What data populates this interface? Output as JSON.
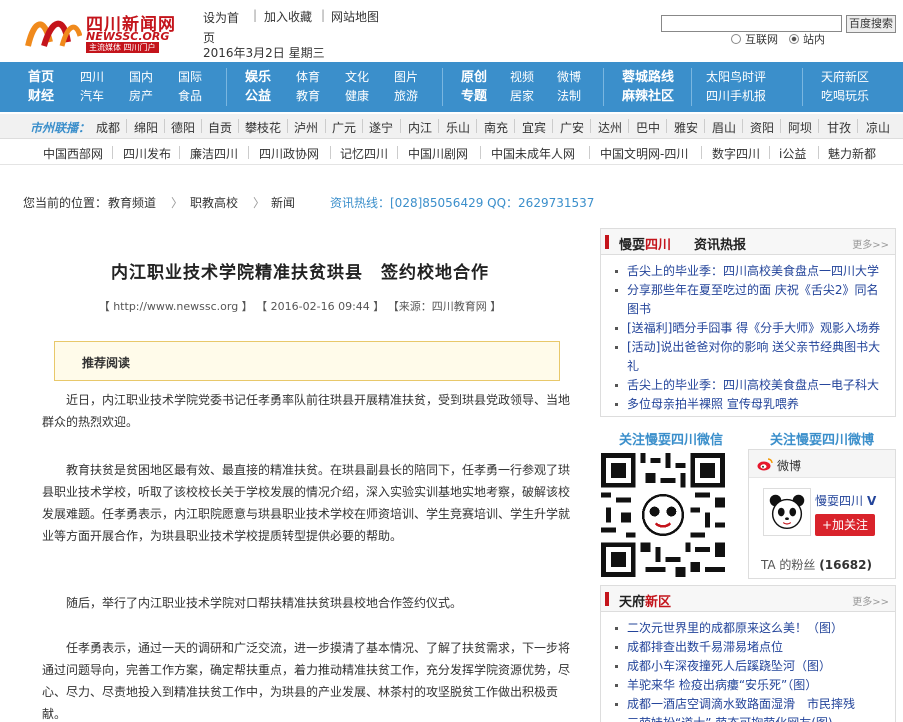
{
  "logo": {
    "name": "四川新闻网",
    "domain": "NEWSSC.ORG",
    "slogan": "主流媒体 四川门户"
  },
  "toplinks": {
    "home": "设为首页",
    "favorite": "加入收藏",
    "sitemap": "网站地图",
    "sep": "|"
  },
  "date": "2016年3月2日 星期三",
  "search": {
    "button": "百度搜索",
    "opt_web": "互联网",
    "opt_site": "站内",
    "selected": "站内"
  },
  "mainnav": [
    {
      "top": "首页",
      "bottom": "财经",
      "bold": true
    },
    {
      "top": "四川",
      "bottom": "汽车"
    },
    {
      "top": "国内",
      "bottom": "房产"
    },
    {
      "top": "国际",
      "bottom": "食品"
    },
    {
      "top": "娱乐",
      "bottom": "公益",
      "bold": true
    },
    {
      "top": "体育",
      "bottom": "教育"
    },
    {
      "top": "文化",
      "bottom": "健康"
    },
    {
      "top": "图片",
      "bottom": "旅游"
    },
    {
      "top": "原创",
      "bottom": "专题",
      "bold": true
    },
    {
      "top": "视频",
      "bottom": "居家"
    },
    {
      "top": "微博",
      "bottom": "法制"
    },
    {
      "top": "蓉城路线",
      "bottom": "麻辣社区",
      "bold": true
    },
    {
      "top": "太阳鸟时评",
      "bottom": "四川手机报"
    },
    {
      "top": "天府新区",
      "bottom": "吃喝玩乐"
    }
  ],
  "citybar": {
    "label": "市州联播：",
    "cities": [
      "成都",
      "绵阳",
      "德阳",
      "自贡",
      "攀枝花",
      "泸州",
      "广元",
      "遂宁",
      "内江",
      "乐山",
      "南充",
      "宜宾",
      "广安",
      "达州",
      "巴中",
      "雅安",
      "眉山",
      "资阳",
      "阿坝",
      "甘孜",
      "凉山"
    ]
  },
  "friendlinks": [
    "中国西部网",
    "四川发布",
    "廉洁四川",
    "四川政协网",
    "记忆四川",
    "中国川剧网",
    "中国未成年人网",
    "中国文明网-四川",
    "数字四川",
    "i公益",
    "魅力新都"
  ],
  "breadcrumb": {
    "label": "您当前的位置：",
    "items": [
      "教育频道",
      "职教高校",
      "新闻"
    ],
    "sep": "〉"
  },
  "hotline": "资讯热线：[028]85056429 QQ：2629731537",
  "article": {
    "title": "内江职业技术学院精准扶贫珙县　签约校地合作",
    "meta": "【 http://www.newssc.org 】 【 2016-02-16 09:44 】 【来源：四川教育网 】",
    "recommend": "推荐阅读",
    "paragraphs": [
      "近日，内江职业技术学院党委书记任孝勇率队前往珙县开展精准扶贫，受到珙县党政领导、当地群众的热烈欢迎。",
      "教育扶贫是贫困地区最有效、最直接的精准扶贫。在珙县副县长的陪同下，任孝勇一行参观了珙县职业技术学校，听取了该校校长关于学校发展的情况介绍，深入实验实训基地实地考察，破解该校发展难题。任孝勇表示，内江职院愿意与珙县职业技术学校在师资培训、学生竞赛培训、学生升学就业等方面开展合作，为珙县职业技术学校提质转型提供必要的帮助。",
      "随后，举行了内江职业技术学院对口帮扶精准扶贫珙县校地合作签约仪式。",
      "任孝勇表示，通过一天的调研和广泛交流，进一步摸清了基本情况、了解了扶贫需求，下一步将通过问题导向，完善工作方案，确定帮扶重点，着力推动精准扶贫工作，充分发挥学院资源优势，尽心、尽力、尽责地投入到精准扶贫工作中，为珙县的产业发展、林茶村的攻坚脱贫工作做出积极贡献。"
    ]
  },
  "hot": {
    "title_a": "慢耍",
    "title_b": "四川",
    "title_c": "资讯热报",
    "more": "更多>>",
    "items": [
      "舌尖上的毕业季：四川高校美食盘点一四川大学",
      "分享那些年在夏至吃过的面 庆祝《舌尖2》同名图书",
      "[送福利]晒分手囧事 得《分手大师》观影入场券",
      "[活动]说出爸爸对你的影响 送父亲节经典图书大礼",
      "舌尖上的毕业季：四川高校美食盘点一电子科大",
      "多位母亲拍半裸照 宣传母乳喂养"
    ]
  },
  "follow": {
    "weixin": "关注慢耍四川微信",
    "weibo": "关注慢耍四川微博"
  },
  "weibo_card": {
    "header": "微博",
    "name": "慢耍四川",
    "badge": "V",
    "follow_btn": "+加关注",
    "fans_label": "TA 的粉丝",
    "fans_count": "(16682)"
  },
  "tianfu": {
    "title_a": "天府",
    "title_b": "新区",
    "more": "更多>>",
    "items": [
      "二次元世界里的成都原来这么美！（图）",
      "成都排查出数千易滞易堵点位",
      "成都小车深夜撞死人后蹊跷坠河（图）",
      "羊驼来华 检疫出病瘻“安乐死”（图）",
      "成都一酒店空调滴水致路面湿滑　市民摔残",
      "三萌娃扮“道士” 萌态可掬萌化网友(图)"
    ]
  },
  "colors": {
    "brand_red": "#c4141b",
    "nav_blue": "#3b8fcb",
    "link_blue": "#23449a"
  }
}
